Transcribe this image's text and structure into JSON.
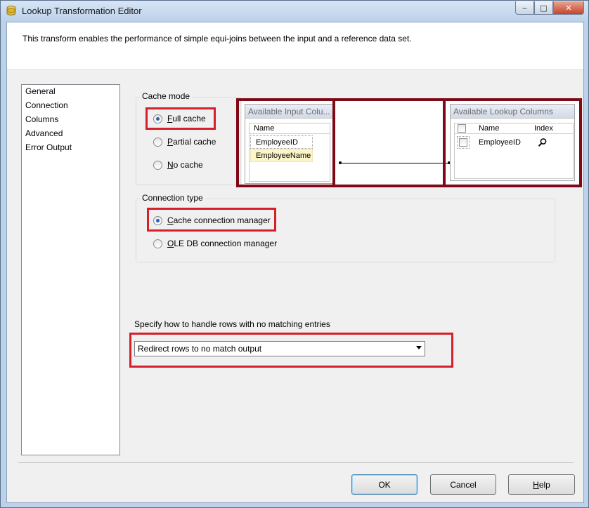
{
  "window": {
    "title": "Lookup Transformation Editor",
    "controls": {
      "minimize": "‒",
      "maximize": "□",
      "close": "✕"
    }
  },
  "description": "This transform enables the performance of simple equi-joins between the input and a reference data set.",
  "nav": {
    "items": [
      "General",
      "Connection",
      "Columns",
      "Advanced",
      "Error Output"
    ],
    "selected": "General"
  },
  "cache_mode": {
    "title": "Cache mode",
    "options": [
      {
        "accel": "F",
        "rest": "ull cache",
        "checked": true
      },
      {
        "accel": "P",
        "rest": "artial cache",
        "checked": false
      },
      {
        "accel": "N",
        "rest": "o cache",
        "checked": false
      }
    ]
  },
  "mapping": {
    "input": {
      "title": "Available Input Colu...",
      "header": "Name",
      "rows": [
        "EmployeeID",
        "EmployeeName"
      ]
    },
    "lookup": {
      "title": "Available Lookup Columns",
      "headers": [
        "Name",
        "Index"
      ],
      "rows": [
        "EmployeeID"
      ],
      "index_icon": "magnifier-icon"
    }
  },
  "connection_type": {
    "title": "Connection type",
    "options": [
      {
        "accel": "C",
        "rest": "ache connection manager",
        "checked": true
      },
      {
        "accel": "O",
        "rest": "LE DB connection manager",
        "checked": false
      }
    ]
  },
  "no_match": {
    "label": "Specify how to handle rows with no matching entries",
    "value": "Redirect rows to no match output"
  },
  "buttons": {
    "ok": "OK",
    "cancel": "Cancel",
    "help_accel": "H",
    "help_rest": "elp"
  },
  "colors": {
    "highlight_red": "#d3202a",
    "highlight_dark": "#7e0a17"
  }
}
